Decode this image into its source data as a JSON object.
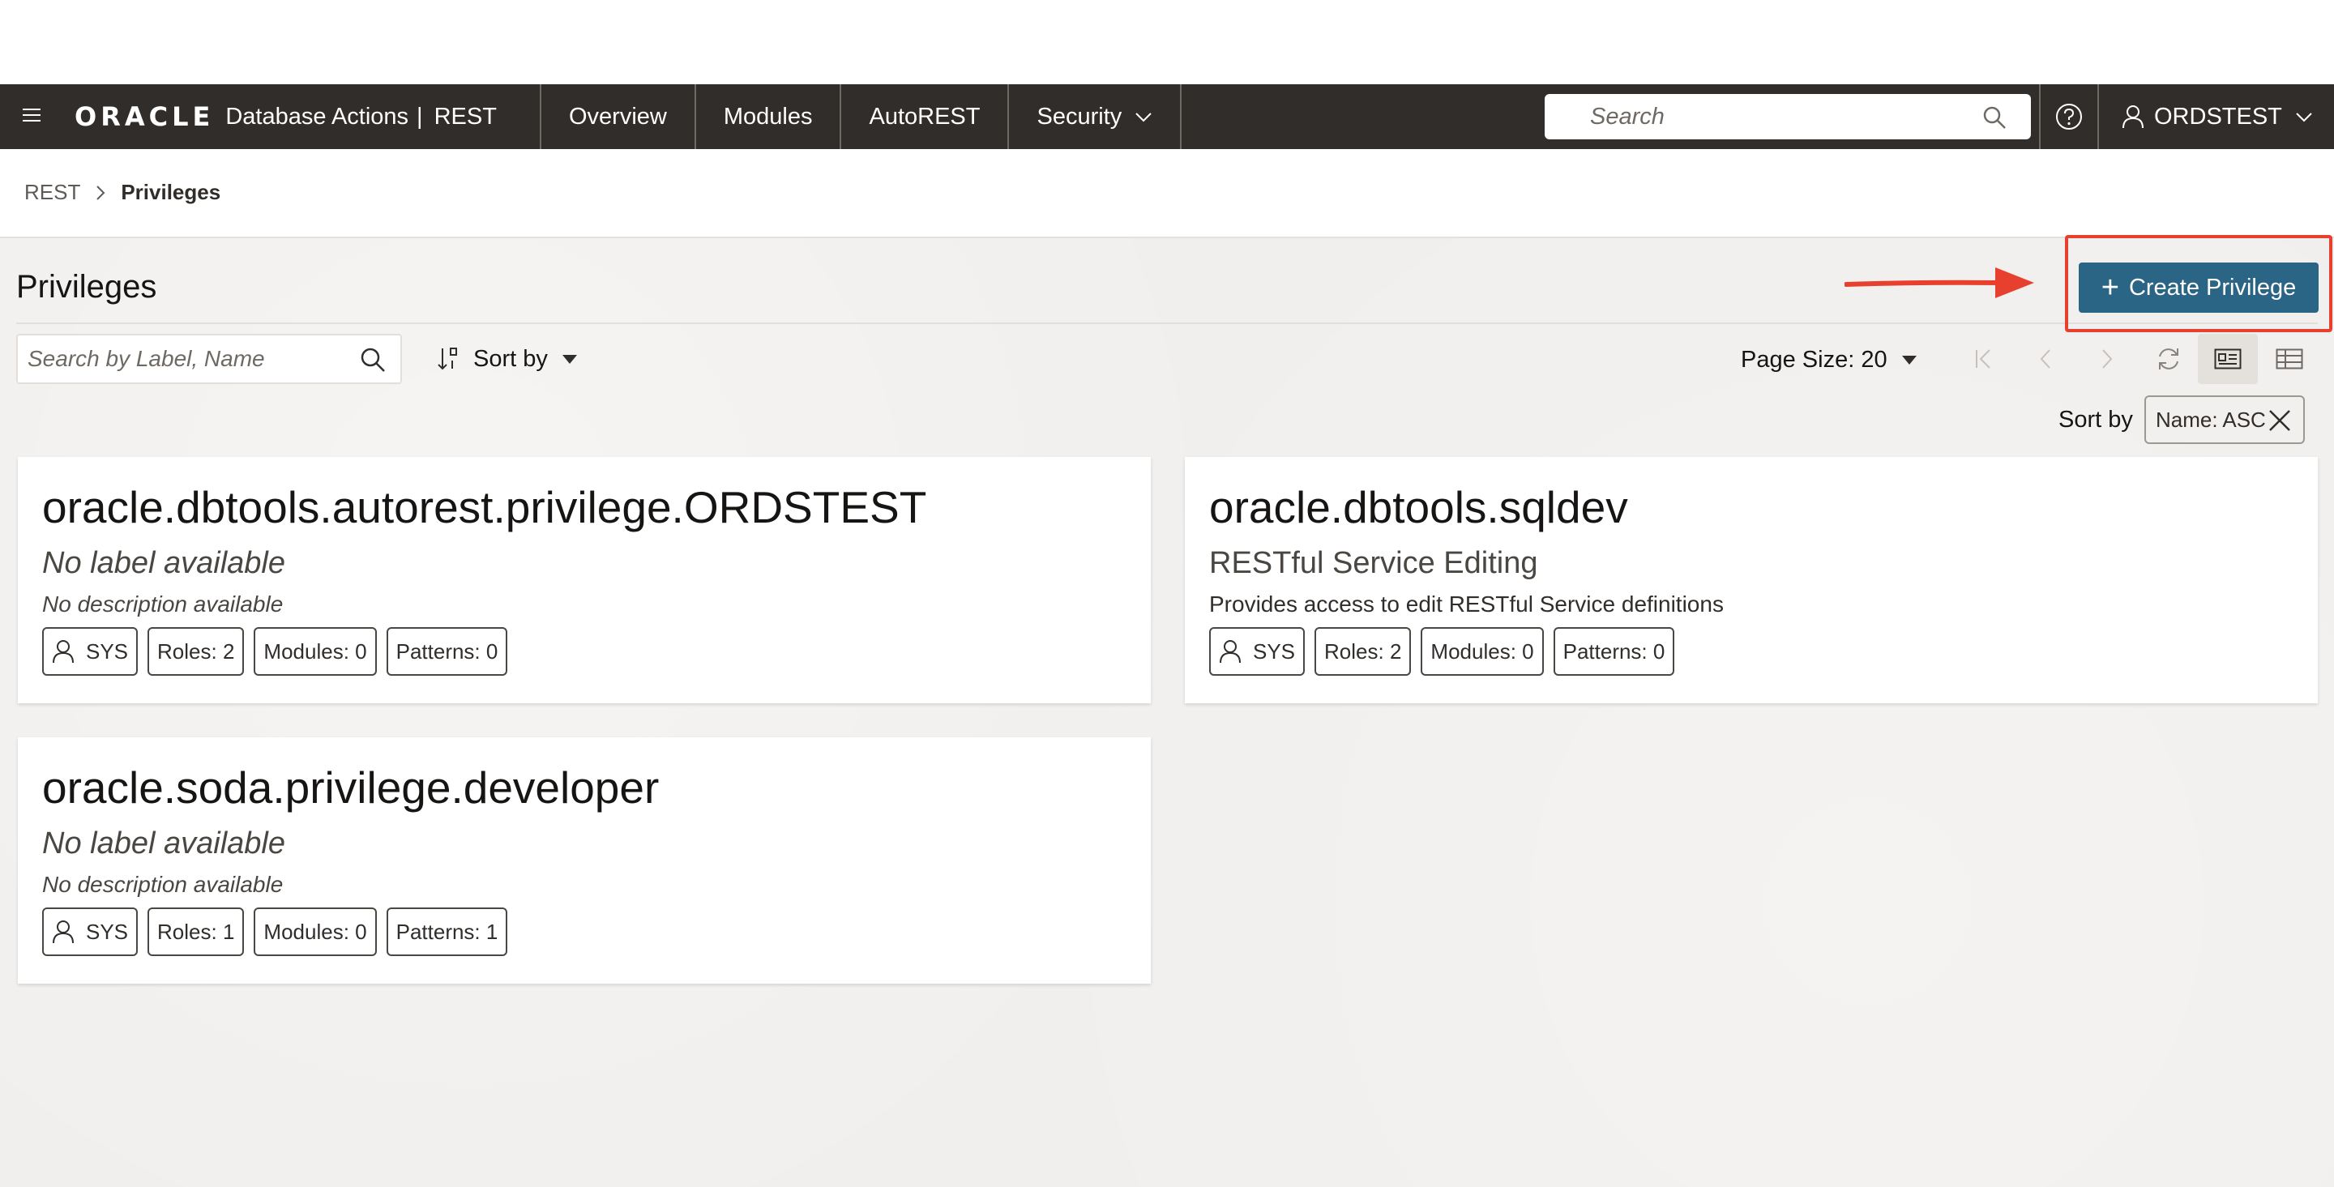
{
  "header": {
    "brand_logo": "ORACLE",
    "app_name": "Database Actions",
    "separator": "|",
    "section": "REST",
    "nav": [
      {
        "label": "Overview"
      },
      {
        "label": "Modules"
      },
      {
        "label": "AutoREST"
      },
      {
        "label": "Security"
      }
    ],
    "search_placeholder": "Search",
    "user": "ORDSTEST"
  },
  "breadcrumb": {
    "parent": "REST",
    "current": "Privileges"
  },
  "page": {
    "title": "Privileges",
    "create_label": "Create Privilege",
    "filter_placeholder": "Search by Label, Name",
    "sort_label": "Sort by",
    "page_size": "Page Size: 20",
    "sortby_label": "Sort by",
    "sort_chip": "Name: ASC"
  },
  "cards": [
    {
      "name": "oracle.dbtools.autorest.privilege.ORDSTEST",
      "label": "No label available",
      "description": "No description available",
      "owner": "SYS",
      "roles": "Roles: 2",
      "modules": "Modules: 0",
      "patterns": "Patterns: 0"
    },
    {
      "name": "oracle.dbtools.sqldev",
      "label": "RESTful Service Editing",
      "description": "Provides access to edit RESTful Service definitions",
      "owner": "SYS",
      "roles": "Roles: 2",
      "modules": "Modules: 0",
      "patterns": "Patterns: 0"
    },
    {
      "name": "oracle.soda.privilege.developer",
      "label": "No label available",
      "description": "No description available",
      "owner": "SYS",
      "roles": "Roles: 1",
      "modules": "Modules: 0",
      "patterns": "Patterns: 1"
    }
  ],
  "colors": {
    "header_bg": "#312d2a",
    "primary_button": "#2b6585",
    "highlight": "#e8402e",
    "content_bg": "#f1efed"
  }
}
